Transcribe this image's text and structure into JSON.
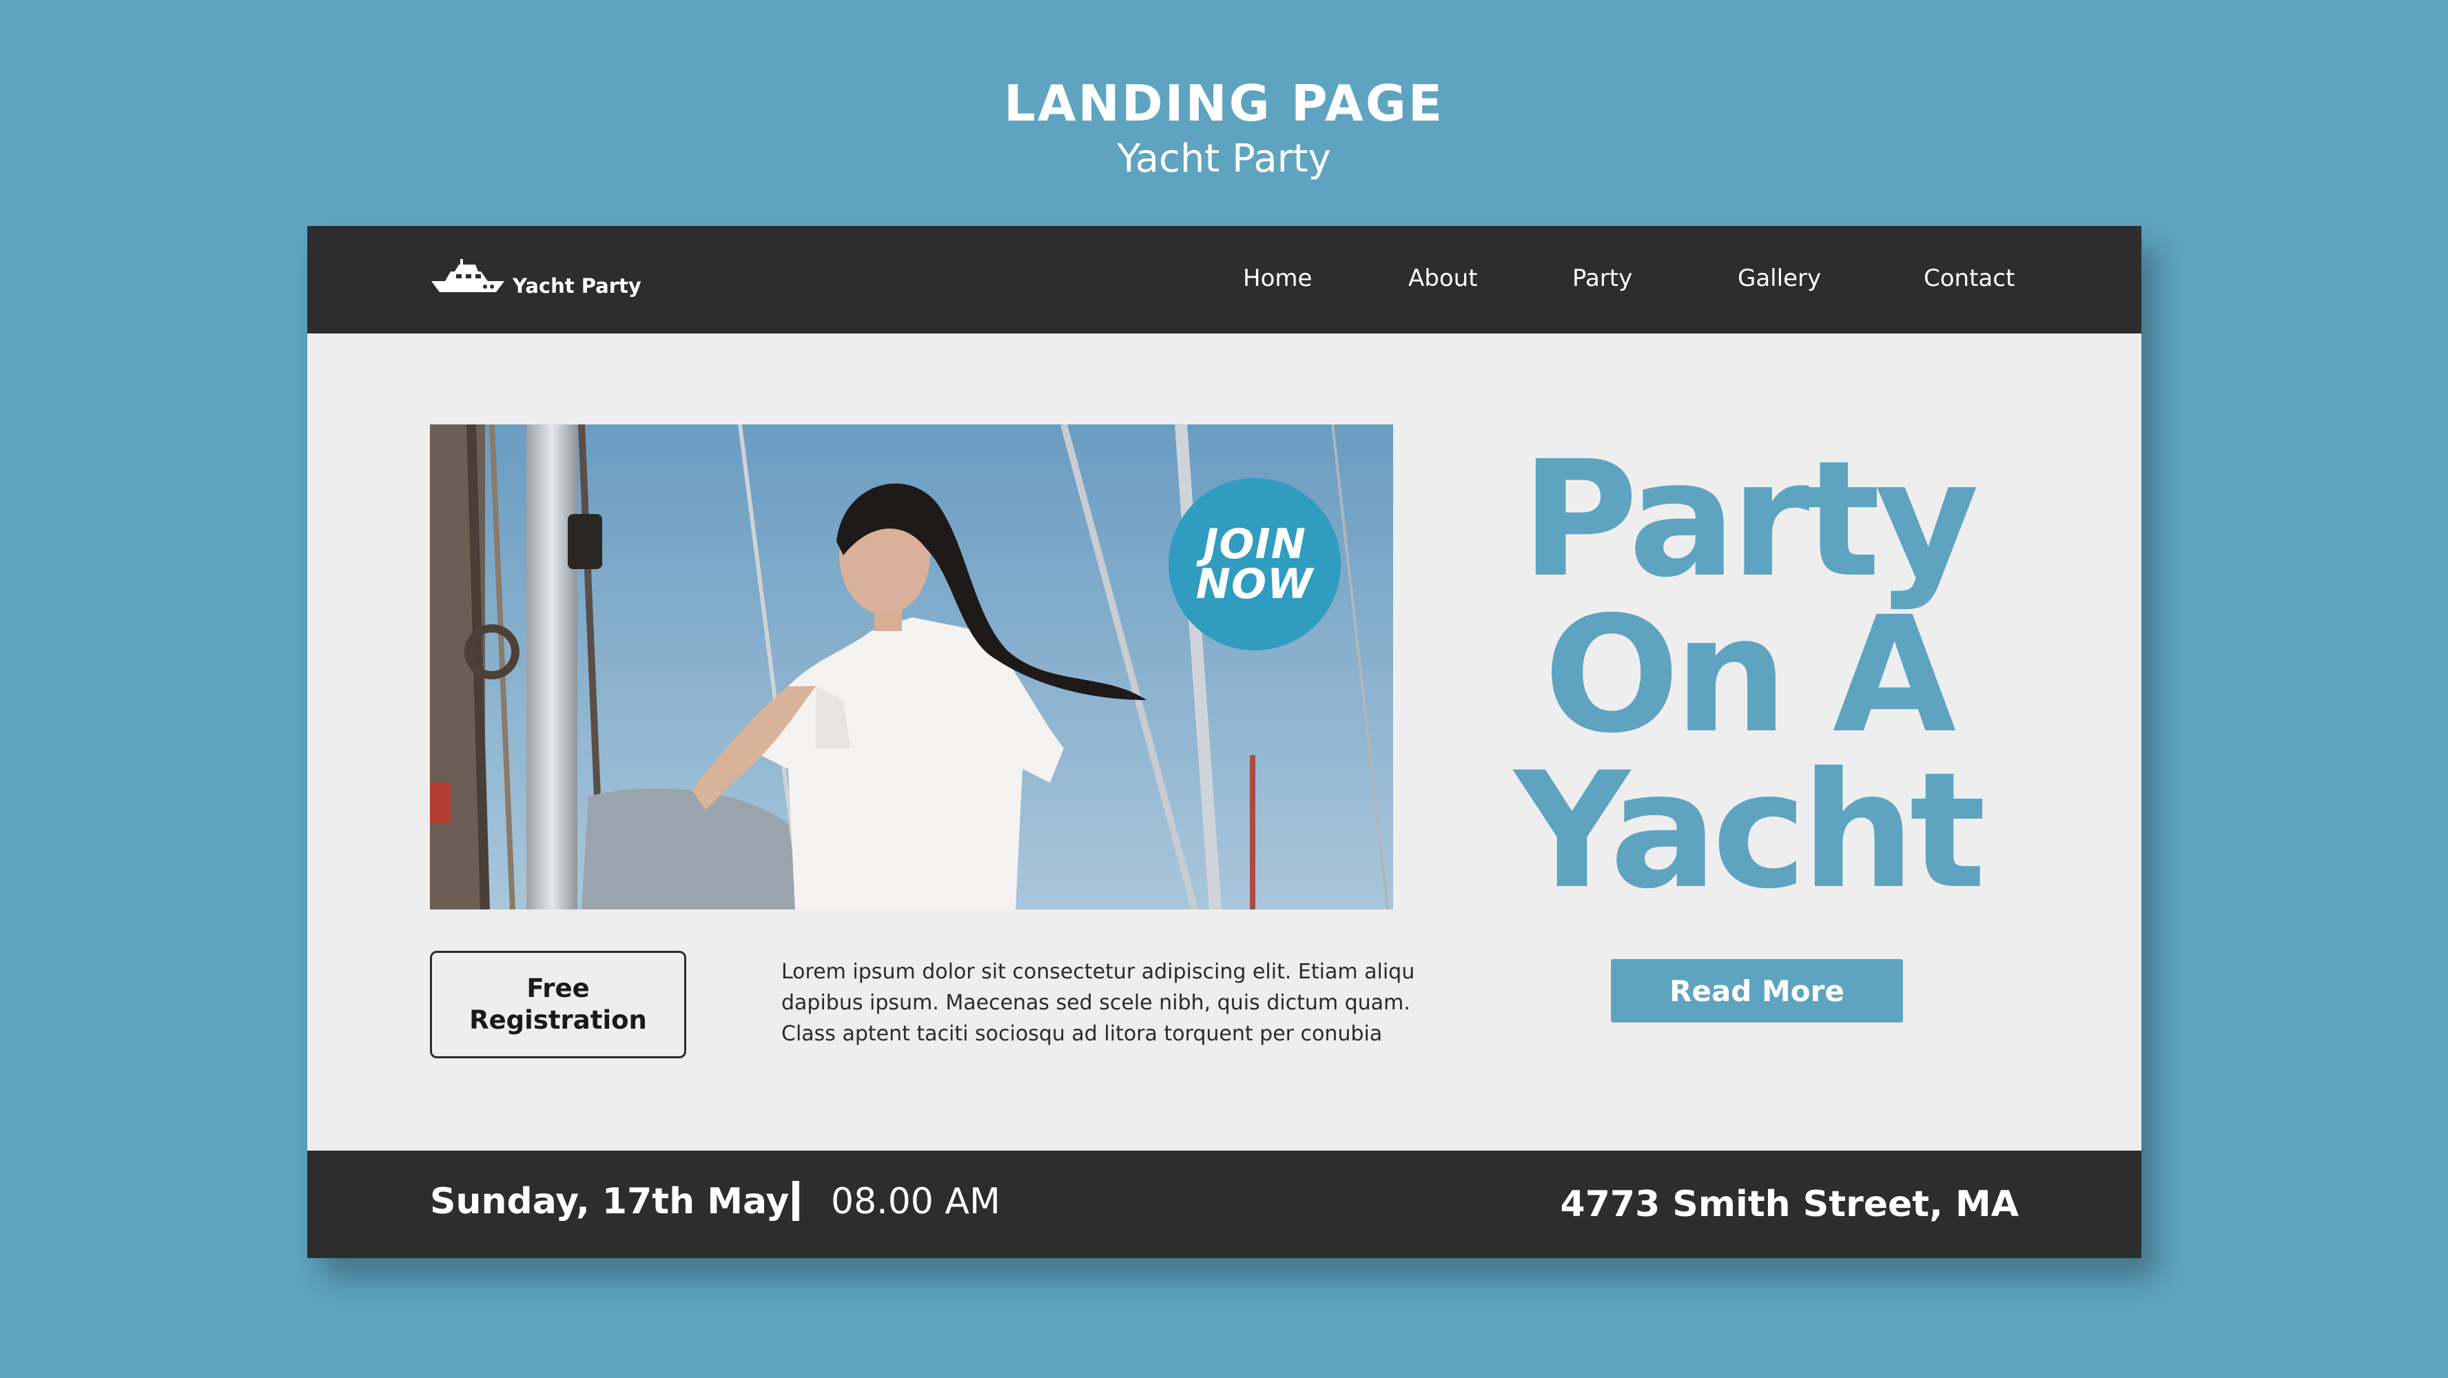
{
  "page": {
    "title": "LANDING PAGE",
    "subtitle": "Yacht Party"
  },
  "navbar": {
    "logo_icon": "yacht-icon",
    "logo_label": "Yacht Party",
    "items": [
      {
        "label": "Home"
      },
      {
        "label": "About"
      },
      {
        "label": "Party"
      },
      {
        "label": "Gallery"
      },
      {
        "label": "Contact"
      }
    ]
  },
  "hero": {
    "image": "woman in white shirt on sailing yacht",
    "badge_line1": "JOIN",
    "badge_line2": "NOW",
    "headline_line1": "Party",
    "headline_line2": "On A",
    "headline_line3": "Yacht",
    "read_more_label": "Read More",
    "free_reg_line1": "Free",
    "free_reg_line2": "Registration",
    "body_lines": [
      "Lorem ipsum dolor sit consectetur adipiscing elit. Etiam aliqu",
      "dapibus ipsum. Maecenas sed scele nibh, quis dictum quam.",
      "Class aptent taciti sociosqu ad litora torquent per conubia"
    ]
  },
  "footer": {
    "date": "Sunday, 17th May",
    "time": "08.00 AM",
    "address": "4773 Smith Street, MA"
  },
  "colors": {
    "background": "#5ea4c0",
    "accent": "#5ea4c0",
    "badge": "#2f9cc0",
    "bar": "#2d2d2d",
    "panel": "#efeeef"
  }
}
